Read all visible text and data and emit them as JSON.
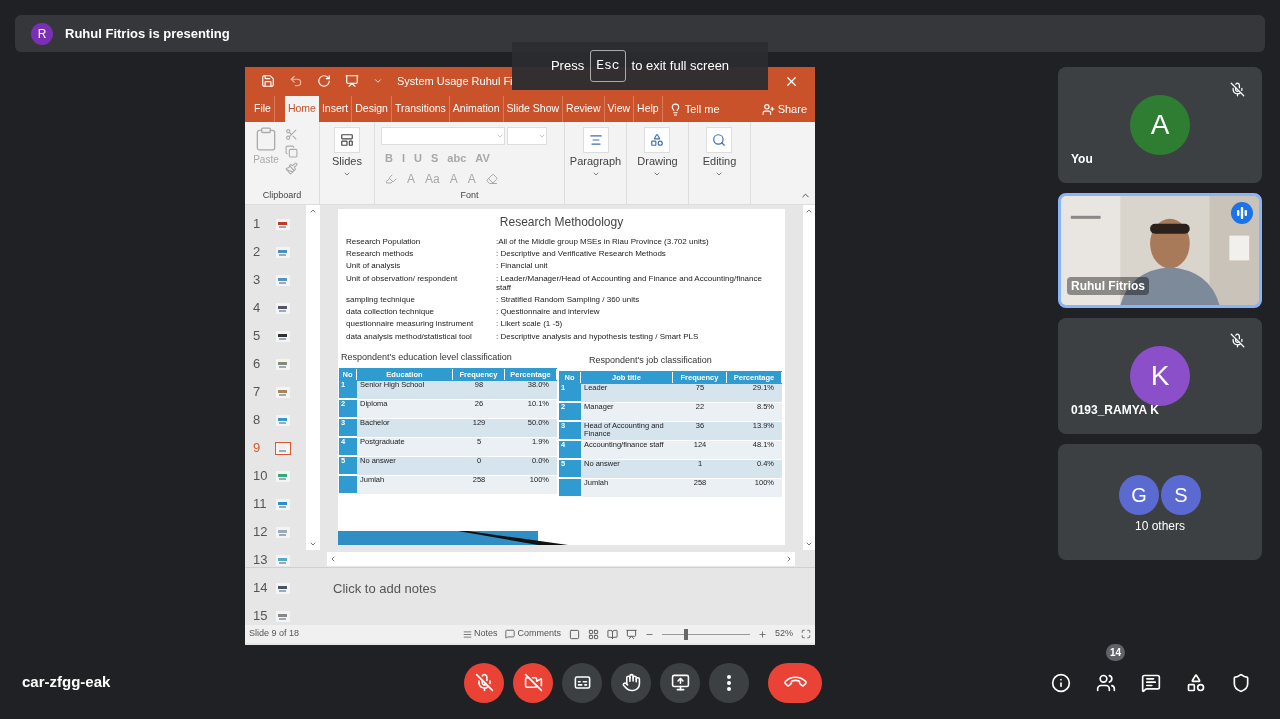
{
  "banner": {
    "avatar": "R",
    "text": "Ruhul Fitrios is presenting"
  },
  "fullscreen_hint": {
    "before": "Press",
    "key": "Esc",
    "after": "to exit full screen"
  },
  "app": {
    "title": "System Usage Ruhul Fi",
    "tabs": [
      {
        "label": "File",
        "selected": false
      },
      {
        "label": "Home",
        "selected": true
      },
      {
        "label": "Insert",
        "selected": false
      },
      {
        "label": "Design",
        "selected": false
      },
      {
        "label": "Transitions",
        "selected": false
      },
      {
        "label": "Animation",
        "selected": false
      },
      {
        "label": "Slide Show",
        "selected": false
      },
      {
        "label": "Review",
        "selected": false
      },
      {
        "label": "View",
        "selected": false
      },
      {
        "label": "Help",
        "selected": false
      }
    ],
    "tell_me": "Tell me",
    "share": "Share",
    "ribbon": {
      "paste": "Paste",
      "slides": "Slides",
      "font_disabled": true,
      "font_row1": [
        "B",
        "I",
        "U",
        "S",
        "abc",
        "AV"
      ],
      "font_row2": [
        "A",
        "Aa",
        "A",
        "A"
      ],
      "paragraph": "Paragraph",
      "drawing": "Drawing",
      "editing": "Editing",
      "clipboard_label": "Clipboard",
      "font_label": "Font"
    },
    "thumbnails": [
      {
        "number": "1",
        "selected": false
      },
      {
        "number": "2",
        "selected": false
      },
      {
        "number": "3",
        "selected": false
      },
      {
        "number": "4",
        "selected": false
      },
      {
        "number": "5",
        "selected": false
      },
      {
        "number": "6",
        "selected": false
      },
      {
        "number": "7",
        "selected": false
      },
      {
        "number": "8",
        "selected": false
      },
      {
        "number": "9",
        "selected": true
      },
      {
        "number": "10",
        "selected": false
      },
      {
        "number": "11",
        "selected": false
      },
      {
        "number": "12",
        "selected": false
      },
      {
        "number": "13",
        "selected": false
      },
      {
        "number": "14",
        "selected": false
      },
      {
        "number": "15",
        "selected": false
      }
    ],
    "slide": {
      "title": "Research Methodology",
      "rows": [
        {
          "label": "Research Population",
          "value": ":All of the Middle group MSEs in Riau Province (3.702 units)"
        },
        {
          "label": "Research methods",
          "value": ": Descriptive and Verificative Research Methods"
        },
        {
          "label": "Unit of analysis",
          "value": ": Financial unit"
        },
        {
          "label": "Unit of observation/ respondent",
          "value": ": Leader/Manager/Head of Accounting and Finance and Accounting/finance staff"
        },
        {
          "label": "sampling technique",
          "value": ": Stratified Random Sampling / 360 units"
        },
        {
          "label": "data collection technique",
          "value": ": Questionnaire and interview"
        },
        {
          "label": "questionnaire measuring instrument",
          "value": ": Likert scale (1 -5)"
        },
        {
          "label": "data analysis method/statistical tool",
          "value": ": Descriptive analysis and hypothesis testing / Smart PLS"
        }
      ],
      "tables": [
        {
          "title": "Respondent's education level classification",
          "columns": [
            "No",
            "Education",
            "Frequency",
            "Percentage"
          ],
          "rows": [
            {
              "no": "1",
              "name": "Senior High School",
              "frequency": "98",
              "percentage": "38.0%"
            },
            {
              "no": "2",
              "name": "Diploma",
              "frequency": "26",
              "percentage": "10.1%"
            },
            {
              "no": "3",
              "name": "Bachelor",
              "frequency": "129",
              "percentage": "50.0%"
            },
            {
              "no": "4",
              "name": "Postgraduate",
              "frequency": "5",
              "percentage": "1.9%"
            },
            {
              "no": "5",
              "name": "No answer",
              "frequency": "0",
              "percentage": "0.0%"
            },
            {
              "name": "Jumlah",
              "frequency": "258",
              "percentage": "100%"
            }
          ]
        },
        {
          "title": "Respondent's job classification",
          "columns": [
            "No",
            "Job title",
            "Frequency",
            "Percentage"
          ],
          "rows": [
            {
              "no": "1",
              "name": "Leader",
              "frequency": "75",
              "percentage": "29.1%"
            },
            {
              "no": "2",
              "name": "Manager",
              "frequency": "22",
              "percentage": "8.5%"
            },
            {
              "no": "3",
              "name": "Head of Accounting and Finance",
              "frequency": "36",
              "percentage": "13.9%"
            },
            {
              "no": "4",
              "name": "Accounting/finance staff",
              "frequency": "124",
              "percentage": "48.1%"
            },
            {
              "no": "5",
              "name": "No answer",
              "frequency": "1",
              "percentage": "0.4%"
            },
            {
              "name": "Jumlah",
              "frequency": "258",
              "percentage": "100%"
            }
          ]
        }
      ]
    },
    "notes_placeholder": "Click to add notes",
    "status_bar": {
      "slide_info": "Slide 9 of 18",
      "notes": "Notes",
      "comments": "Comments",
      "zoom": {
        "level": 0.25
      },
      "zoom_reading": "52%"
    }
  },
  "participants": [
    {
      "kind": "avatar",
      "name": "You",
      "initial": "A",
      "color": "#2f7d32",
      "muted": true,
      "selected": false
    },
    {
      "kind": "video",
      "name": "Ruhul Fitrios",
      "speaking": true,
      "selected": true
    },
    {
      "kind": "avatar",
      "name": "0193_RAMYA K",
      "initial": "K",
      "color": "#8a4fc9",
      "muted": true,
      "selected": false
    },
    {
      "kind": "group",
      "name": "10 others",
      "avatars": [
        {
          "initial": "G",
          "color": "#5b6ad0"
        },
        {
          "initial": "S",
          "color": "#5b6ad0"
        }
      ],
      "selected": false
    }
  ],
  "meeting_code": "car-zfgg-eak",
  "controls": [
    {
      "kind": "mic",
      "on": false
    },
    {
      "kind": "camera",
      "on": false
    },
    {
      "kind": "captions"
    },
    {
      "kind": "hand"
    },
    {
      "kind": "present"
    },
    {
      "kind": "more"
    },
    {
      "kind": "end"
    }
  ],
  "side_buttons": [
    {
      "kind": "info"
    },
    {
      "kind": "people",
      "badge": "14"
    },
    {
      "kind": "chat"
    },
    {
      "kind": "activities"
    },
    {
      "kind": "safety"
    }
  ]
}
